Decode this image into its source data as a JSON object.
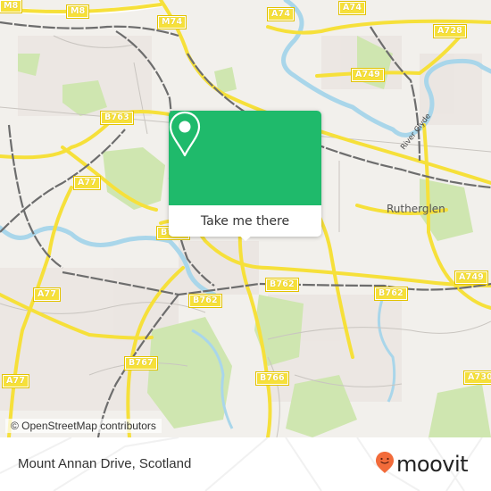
{
  "map": {
    "road_labels": [
      {
        "label": "M8",
        "kind": "motorway"
      },
      {
        "label": "M8",
        "kind": "motorway"
      },
      {
        "label": "M74",
        "kind": "motorway"
      },
      {
        "label": "A74",
        "kind": "a-road"
      },
      {
        "label": "A74",
        "kind": "a-road"
      },
      {
        "label": "A728",
        "kind": "a-road"
      },
      {
        "label": "A749",
        "kind": "a-road"
      },
      {
        "label": "B763",
        "kind": "b-road"
      },
      {
        "label": "A77",
        "kind": "a-road"
      },
      {
        "label": "B768",
        "kind": "b-road"
      },
      {
        "label": "A77",
        "kind": "a-road"
      },
      {
        "label": "B762",
        "kind": "b-road"
      },
      {
        "label": "B762",
        "kind": "b-road"
      },
      {
        "label": "B762",
        "kind": "b-road"
      },
      {
        "label": "A749",
        "kind": "a-road"
      },
      {
        "label": "B767",
        "kind": "b-road"
      },
      {
        "label": "B766",
        "kind": "b-road"
      },
      {
        "label": "A77",
        "kind": "a-road"
      },
      {
        "label": "A730",
        "kind": "a-road"
      }
    ],
    "place_labels": {
      "rutherglen": "Rutherglen",
      "river": "River Clyde"
    },
    "attribution": "© OpenStreetMap contributors",
    "colors": {
      "land": "#f2f0ec",
      "park": "#cfe6b0",
      "water": "#a9d6ea",
      "road": "#f6e03a",
      "rail": "#6d6d6d"
    }
  },
  "popup": {
    "icon": "location-pin-icon",
    "button_label": "Take me there",
    "color": "#1fba6b"
  },
  "footer": {
    "address": "Mount Annan Drive, Scotland",
    "brand": "moovit",
    "brand_icon": "moovit-smile-pin-icon",
    "brand_color": "#f26b3a"
  }
}
